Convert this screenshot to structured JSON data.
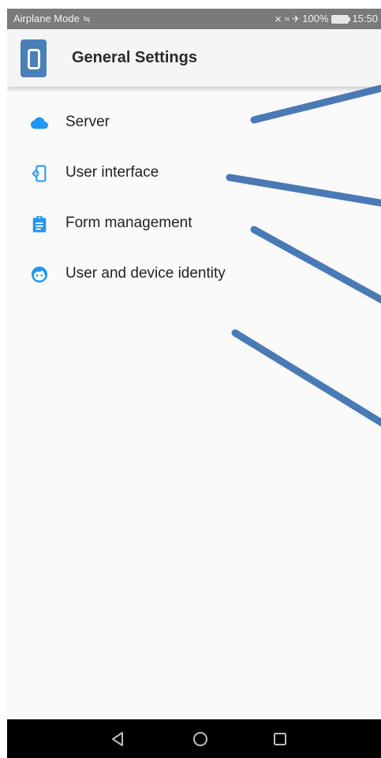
{
  "status_bar": {
    "mode_text": "Airplane Mode",
    "battery_text": "100%",
    "time": "15:50",
    "icons": [
      "sim-icon",
      "mute-icon",
      "wifi-icon",
      "airplane-icon",
      "battery-icon"
    ]
  },
  "app_bar": {
    "title": "General Settings",
    "logo_icon": "phone-frame-icon"
  },
  "settings_items": [
    {
      "label": "Server",
      "icon": "cloud-icon"
    },
    {
      "label": "User interface",
      "icon": "device-settings-icon"
    },
    {
      "label": "Form management",
      "icon": "clipboard-icon"
    },
    {
      "label": "User and device identity",
      "icon": "face-icon"
    }
  ],
  "nav_bar": {
    "buttons": [
      "back-icon",
      "home-icon",
      "recents-icon"
    ]
  },
  "colors": {
    "accent_blue": "#2196f3",
    "callout_line": "#4a7ab5",
    "status_bar": "#7a7a7a",
    "app_logo": "#4a7fb8",
    "nav_bar": "#000000"
  }
}
